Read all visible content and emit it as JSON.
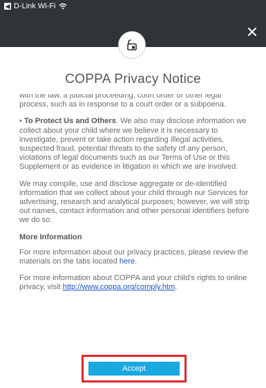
{
  "status_bar": {
    "carrier": "D-Link Wi-Fi"
  },
  "header": {
    "title": "COPPA Privacy Notice",
    "badge_icon": "lock-icon",
    "close_icon": "close-icon"
  },
  "notice": {
    "para1": "with the law, a judicial proceeding, court order or other legal process, such as in response to a court order or a subpoena.",
    "para2_bullet": "•",
    "para2_title": "To Protect Us and Others",
    "para2_text": ". We also may disclose information we collect about your child where we believe it is necessary to investigate, prevent or take action regarding illegal activities, suspected fraud, potential threats to the safety of any person, violations of legal documents such as our Terms of Use or this Supplement or as evidence in litigation in which we are involved.",
    "para3": "We may compile, use and disclose aggregate or de-identified information that we collect about your child through our Services for advertising, research and analytical purposes; however, we will strip out names, contact information and other personal identifiers before we do so.",
    "more_heading": "More Information",
    "para4_text": "For more information about our privacy practices, please review the materials on the tabs located ",
    "para4_link": "here",
    "para4_end": ".",
    "para5_text": "For more information about COPPA and your child's rights to online privacy, visit ",
    "para5_link": "http://www.coppa.org/comply.htm",
    "para5_end": "."
  },
  "footer": {
    "accept_label": "Accept"
  },
  "colors": {
    "header_bg": "#2f3537",
    "accent": "#19a8e0",
    "highlight": "#e0262b",
    "link": "#1a55c9"
  }
}
